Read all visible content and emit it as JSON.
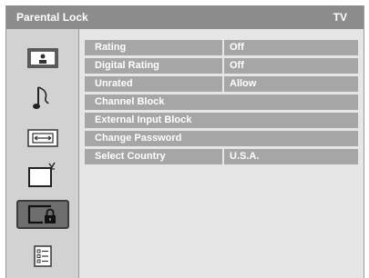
{
  "header": {
    "title": "Parental Lock",
    "source": "TV"
  },
  "sidebar": {
    "items": [
      {
        "icon": "picture-icon",
        "selected": false
      },
      {
        "icon": "sound-icon",
        "selected": false
      },
      {
        "icon": "screen-icon",
        "selected": false
      },
      {
        "icon": "channel-icon",
        "selected": false
      },
      {
        "icon": "parental-lock-icon",
        "selected": true
      },
      {
        "icon": "setup-icon",
        "selected": false
      }
    ]
  },
  "menu": {
    "rows": [
      {
        "label": "Rating",
        "value": "Off"
      },
      {
        "label": "Digital Rating",
        "value": "Off"
      },
      {
        "label": "Unrated",
        "value": "Allow"
      },
      {
        "label": "Channel Block",
        "value": ""
      },
      {
        "label": "External Input Block",
        "value": ""
      },
      {
        "label": "Change Password",
        "value": ""
      },
      {
        "label": "Select Country",
        "value": "U.S.A."
      }
    ]
  },
  "colors": {
    "title_bar": "#8c8c8c",
    "row_background": "#a6a6a6",
    "selected_icon": "#6e6e6e",
    "panel_background": "#e6e6e6"
  }
}
